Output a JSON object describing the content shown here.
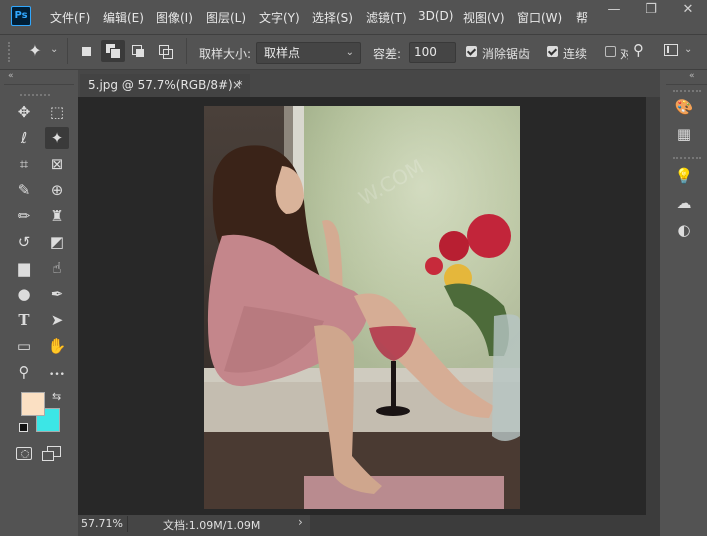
{
  "menu": {
    "logo": "Ps",
    "items": [
      "文件(F)",
      "编辑(E)",
      "图像(I)",
      "图层(L)",
      "文字(Y)",
      "选择(S)",
      "滤镜(T)",
      "3D(D)",
      "视图(V)",
      "窗口(W)",
      "帮"
    ],
    "window_controls": [
      "—",
      "❐",
      "✕"
    ]
  },
  "options": {
    "sample_size_label": "取样大小:",
    "sample_size_value": "取样点",
    "tolerance_label": "容差:",
    "tolerance_value": "100",
    "anti_alias_label": "消除锯齿",
    "anti_alias_checked": true,
    "contiguous_label": "连续",
    "contiguous_checked": true,
    "sample_all_label": "对",
    "sample_all_checked": false
  },
  "document": {
    "tab_title": "5.jpg @ 57.7%(RGB/8#) *",
    "tab_close": "×",
    "zoom": "57.71%",
    "doc_info": "文档:1.09M/1.09M",
    "status_arrow": "›"
  },
  "colors": {
    "foreground": "#fbe0c3",
    "background": "#3ce6e6",
    "ui_bg": "#535353",
    "canvas_bg": "#282828"
  },
  "tools": [
    {
      "name": "move-tool",
      "icon": "move-icon",
      "glyph": "✥"
    },
    {
      "name": "marquee-tool",
      "icon": "rect-marquee-icon",
      "glyph": "⬚"
    },
    {
      "name": "lasso-tool",
      "icon": "lasso-icon",
      "glyph": "ℓ"
    },
    {
      "name": "magic-wand-tool",
      "icon": "magic-wand-icon",
      "glyph": "✦"
    },
    {
      "name": "crop-tool",
      "icon": "crop-icon",
      "glyph": "⌗"
    },
    {
      "name": "frame-tool",
      "icon": "frame-icon",
      "glyph": "⊠"
    },
    {
      "name": "eyedropper-tool",
      "icon": "eyedropper-icon",
      "glyph": "✎"
    },
    {
      "name": "healing-tool",
      "icon": "healing-icon",
      "glyph": "⊕"
    },
    {
      "name": "brush-tool",
      "icon": "brush-icon",
      "glyph": "✏"
    },
    {
      "name": "stamp-tool",
      "icon": "stamp-icon",
      "glyph": "♜"
    },
    {
      "name": "history-brush-tool",
      "icon": "history-brush-icon",
      "glyph": "↺"
    },
    {
      "name": "eraser-tool",
      "icon": "eraser-icon",
      "glyph": "◩"
    },
    {
      "name": "gradient-tool",
      "icon": "gradient-icon",
      "glyph": "▆"
    },
    {
      "name": "smudge-tool",
      "icon": "smudge-icon",
      "glyph": "☝"
    },
    {
      "name": "dodge-tool",
      "icon": "dodge-icon",
      "glyph": "●"
    },
    {
      "name": "pen-tool",
      "icon": "pen-icon",
      "glyph": "✒"
    },
    {
      "name": "type-tool",
      "icon": "type-icon",
      "glyph": "T"
    },
    {
      "name": "path-select-tool",
      "icon": "arrow-icon",
      "glyph": "➤"
    },
    {
      "name": "shape-tool",
      "icon": "rectangle-icon",
      "glyph": "▭"
    },
    {
      "name": "hand-tool",
      "icon": "hand-icon",
      "glyph": "✋"
    },
    {
      "name": "zoom-tool",
      "icon": "zoom-icon",
      "glyph": "⚲"
    },
    {
      "name": "more-tools",
      "icon": "ellipsis-icon",
      "glyph": "•••"
    }
  ],
  "right_panel": [
    {
      "name": "color-panel-button",
      "icon": "palette-icon",
      "glyph": "🎨"
    },
    {
      "name": "swatches-panel-button",
      "icon": "grid-icon",
      "glyph": "▦"
    },
    {
      "name": "learn-panel-button",
      "icon": "lightbulb-icon",
      "glyph": "💡"
    },
    {
      "name": "libraries-panel-button",
      "icon": "cloud-icon",
      "glyph": "☁"
    },
    {
      "name": "adjustments-panel-button",
      "icon": "half-circle-icon",
      "glyph": "◐"
    }
  ]
}
